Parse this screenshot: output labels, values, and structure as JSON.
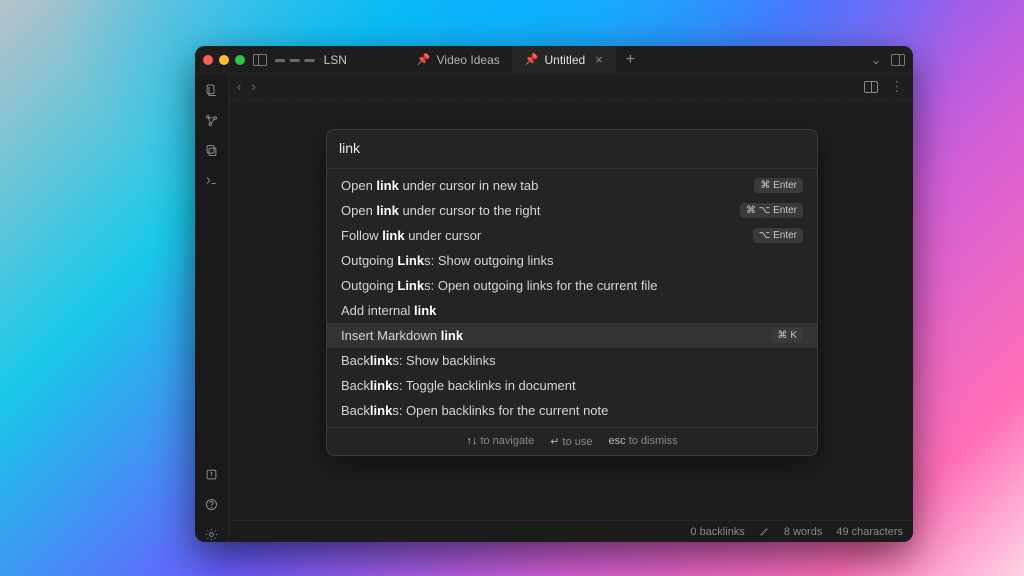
{
  "titlebar": {
    "vault": "LSN",
    "dashes": "▬ ▬ ▬"
  },
  "tabs": [
    {
      "label": "Video Ideas",
      "pinned": true,
      "active": false,
      "closable": false
    },
    {
      "label": "Untitled",
      "pinned": true,
      "active": true,
      "closable": true
    }
  ],
  "palette": {
    "query": "link",
    "items": [
      {
        "pre": "Open ",
        "bold": "link",
        "post": " under cursor in new tab",
        "shortcut": "⌘ Enter",
        "selected": false
      },
      {
        "pre": "Open ",
        "bold": "link",
        "post": " under cursor to the right",
        "shortcut": "⌘ ⌥ Enter",
        "selected": false
      },
      {
        "pre": "Follow ",
        "bold": "link",
        "post": " under cursor",
        "shortcut": "⌥ Enter",
        "selected": false
      },
      {
        "pre": "Outgoing ",
        "bold": "Link",
        "post": "s: Show outgoing links",
        "shortcut": "",
        "selected": false
      },
      {
        "pre": "Outgoing ",
        "bold": "Link",
        "post": "s: Open outgoing links for the current file",
        "shortcut": "",
        "selected": false
      },
      {
        "pre": "Add internal ",
        "bold": "link",
        "post": "",
        "shortcut": "",
        "selected": false
      },
      {
        "pre": "Insert Markdown ",
        "bold": "link",
        "post": "",
        "shortcut": "⌘ K",
        "selected": true
      },
      {
        "pre": "Back",
        "bold": "link",
        "post": "s: Show backlinks",
        "shortcut": "",
        "selected": false
      },
      {
        "pre": "Back",
        "bold": "link",
        "post": "s: Toggle backlinks in document",
        "shortcut": "",
        "selected": false
      },
      {
        "pre": "Back",
        "bold": "link",
        "post": "s: Open backlinks for the current note",
        "shortcut": "",
        "selected": false
      }
    ],
    "footer": {
      "nav": "to navigate",
      "navkeys": "↑↓",
      "use": "to use",
      "usekey": "↵",
      "dismiss": "to dismiss",
      "dismisskey": "esc"
    }
  },
  "status": {
    "backlinks": "0 backlinks",
    "words": "8 words",
    "chars": "49 characters"
  }
}
